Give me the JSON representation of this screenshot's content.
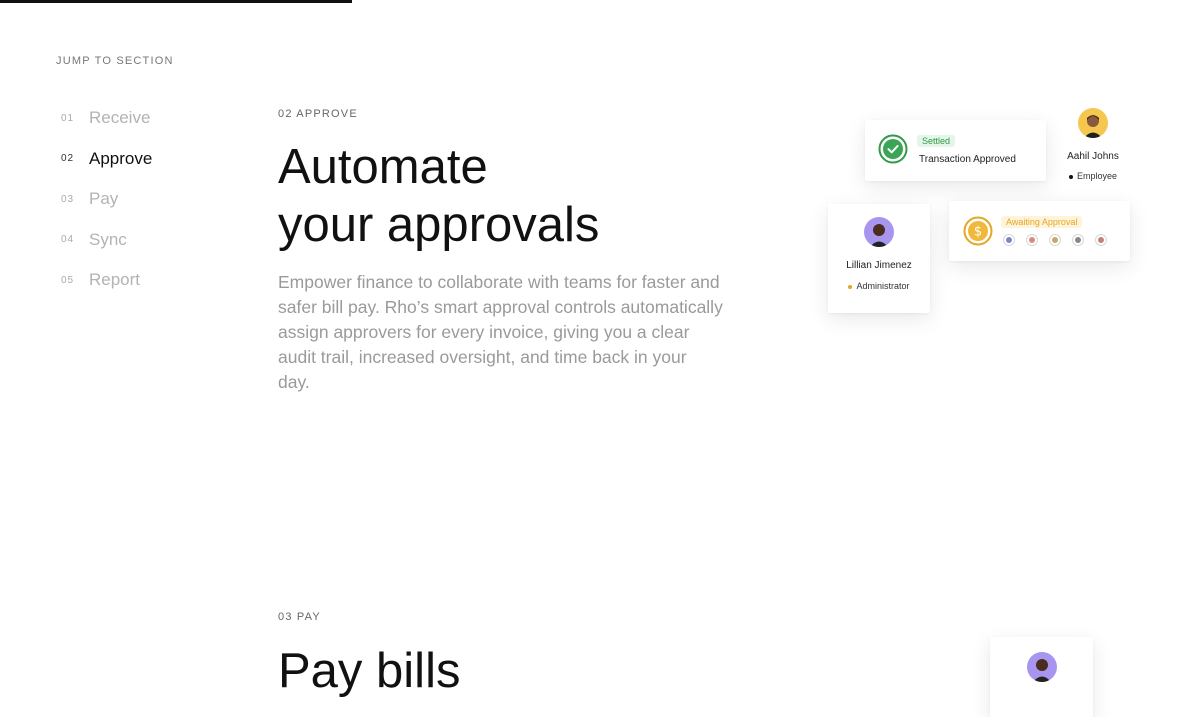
{
  "nav": {
    "title": "JUMP TO SECTION",
    "items": [
      {
        "num": "01",
        "label": "Receive"
      },
      {
        "num": "02",
        "label": "Approve"
      },
      {
        "num": "03",
        "label": "Pay"
      },
      {
        "num": "04",
        "label": "Sync"
      },
      {
        "num": "05",
        "label": "Report"
      }
    ],
    "active_index": 1
  },
  "scroll_progress_fraction": 0.29,
  "approve": {
    "eyebrow": "02 APPROVE",
    "headline_line1": "Automate",
    "headline_line2": "your approvals",
    "body": "Empower finance to collaborate with teams for faster and safer bill pay. Rho’s smart approval controls automatically assign approvers for every invoice, giving you a clear audit trail, increased oversight, and time back in your day."
  },
  "illustration": {
    "transaction": {
      "badge": "Settled",
      "text": "Transaction Approved",
      "icon": "check-circle-icon"
    },
    "aahil": {
      "name": "Aahil Johns",
      "role": "Employee"
    },
    "lillian": {
      "name": "Lillian Jimenez",
      "role": "Administrator"
    },
    "approval": {
      "badge": "Awaiting Approval",
      "icon": "dollar-coin-icon"
    }
  },
  "pay": {
    "eyebrow": "03 PAY",
    "headline": "Pay bills"
  },
  "colors": {
    "settled_green": "#2f9a48",
    "awaiting_gold": "#e3a629",
    "avatar_purple": "#a895f0",
    "avatar_yellow": "#f6c74f"
  }
}
